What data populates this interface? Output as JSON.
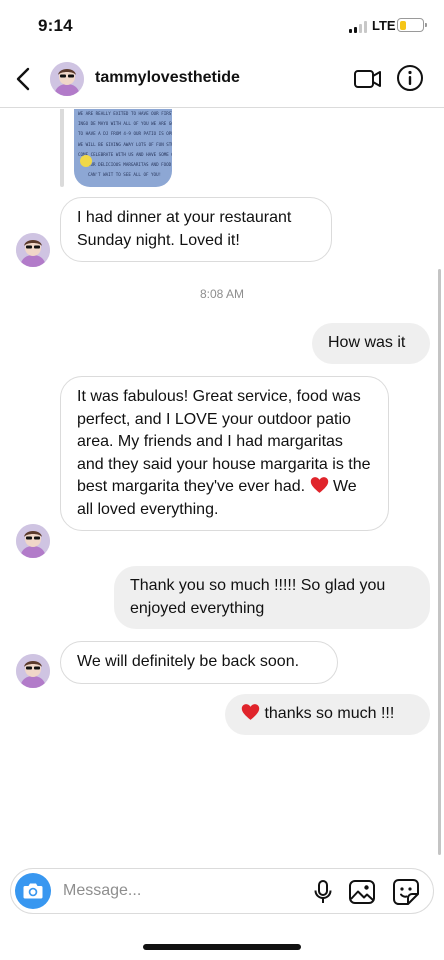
{
  "status_bar": {
    "time": "9:14",
    "network": "LTE",
    "battery_level": 0.3,
    "battery_color": "#f5c518"
  },
  "header": {
    "back_icon": "chevron-left-icon",
    "username": "tammylovesthetide",
    "video_icon": "video-camera-icon",
    "info_icon": "info-icon"
  },
  "shared_image": {
    "lines": [
      "WE ARE REALLY EXITED TO HAVE OUR FIRST",
      "INGO DE MAYO WITH ALL OF YOU WE ARE GOIN",
      "TO HAVE A DJ FROM 4-9 OUR PATIO IS OPEN AN",
      "WE WILL BE GIVING AWAY LOTS OF FUN STUFF",
      "COME CELEBRATE WITH US AND HAVE SOME OF",
      "OUR DELICIOUS MARGARITAS AND FOOD!",
      "CAN'T WAIT TO SEE ALL OF YOU!"
    ]
  },
  "messages": [
    {
      "id": "m1",
      "direction": "incoming",
      "text": "I had dinner at your restaurant Sunday night. Loved it!"
    },
    {
      "id": "ts1",
      "type": "timestamp",
      "text": "8:08 AM"
    },
    {
      "id": "m2",
      "direction": "outgoing",
      "text": "How was it"
    },
    {
      "id": "m3",
      "direction": "incoming",
      "text": "It was fabulous!  Great service,  food was perfect,  and I LOVE your outdoor patio area.  My friends and I had margaritas and they said your house margarita is the best margarita they've ever had.",
      "emoji": "red-heart",
      "text_after": " We all loved everything."
    },
    {
      "id": "m4",
      "direction": "outgoing",
      "text": "Thank you so much !!!!! So glad you enjoyed everything"
    },
    {
      "id": "m5",
      "direction": "incoming",
      "text": "We will definitely be back soon."
    },
    {
      "id": "m6",
      "direction": "outgoing",
      "emoji": "red-heart",
      "text": " thanks so much !!!"
    }
  ],
  "composer": {
    "placeholder": "Message...",
    "camera_icon": "camera-icon",
    "mic_icon": "microphone-icon",
    "gallery_icon": "gallery-icon",
    "sticker_icon": "sticker-icon",
    "accent_color": "#3897f0"
  },
  "colors": {
    "incoming_bubble_border": "#dbdbdb",
    "outgoing_bubble_bg": "#efefef",
    "heart": "#e0242b"
  }
}
